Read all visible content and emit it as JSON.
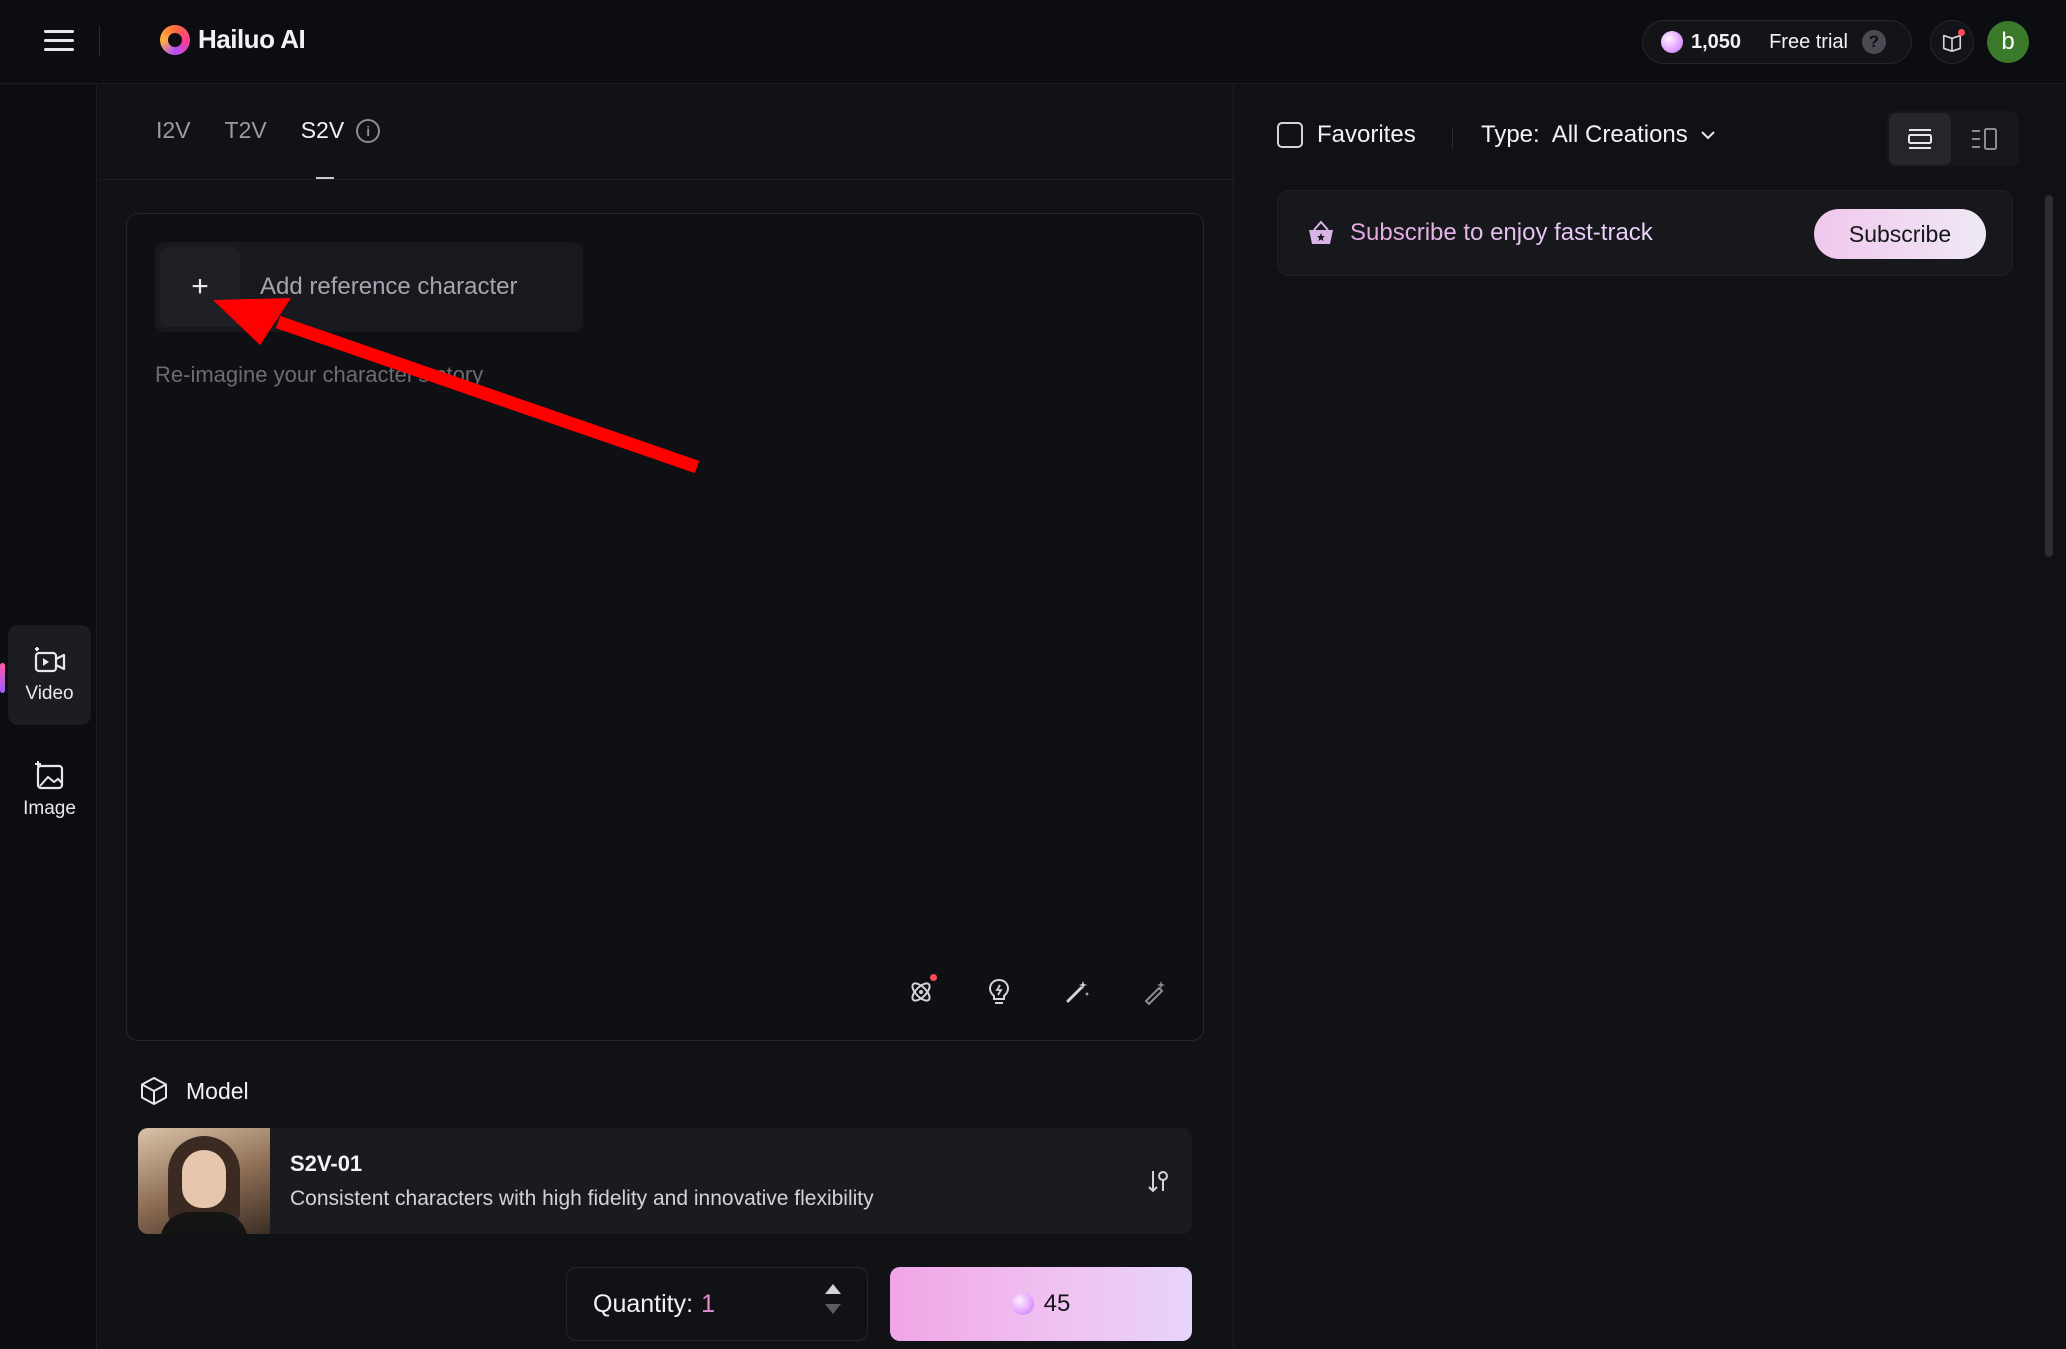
{
  "app": {
    "name": "Hailuo AI"
  },
  "header": {
    "credits": "1,050",
    "free_trial_label": "Free trial",
    "avatar_initial": "b"
  },
  "rail": {
    "items": [
      {
        "label": "Video",
        "icon": "video-icon",
        "active": true
      },
      {
        "label": "Image",
        "icon": "image-icon",
        "active": false
      }
    ]
  },
  "creation": {
    "tabs": [
      {
        "label": "I2V",
        "active": false
      },
      {
        "label": "T2V",
        "active": false
      },
      {
        "label": "S2V",
        "active": true
      }
    ],
    "add_reference_label": "Add reference character",
    "prompt_placeholder": "Re-imagine your character's story",
    "tools": [
      "subject-reference-icon",
      "inspiration-bulb-icon",
      "magic-wand-icon",
      "prompt-enhance-icon"
    ]
  },
  "model": {
    "section_label": "Model",
    "name": "S2V-01",
    "description": "Consistent characters with high fidelity and innovative flexibility"
  },
  "quantity": {
    "label": "Quantity:",
    "value": "1"
  },
  "generate": {
    "cost": "45"
  },
  "library": {
    "favorites_label": "Favorites",
    "type_label": "Type:",
    "type_value": "All Creations",
    "subscribe_text": "Subscribe to enjoy fast-track",
    "subscribe_button": "Subscribe"
  },
  "colors": {
    "accent_pink": "#f1a5e6",
    "quantity_value": "#e38cd6",
    "annotation_arrow": "#ff0000",
    "avatar_bg": "#3b7a2a"
  }
}
